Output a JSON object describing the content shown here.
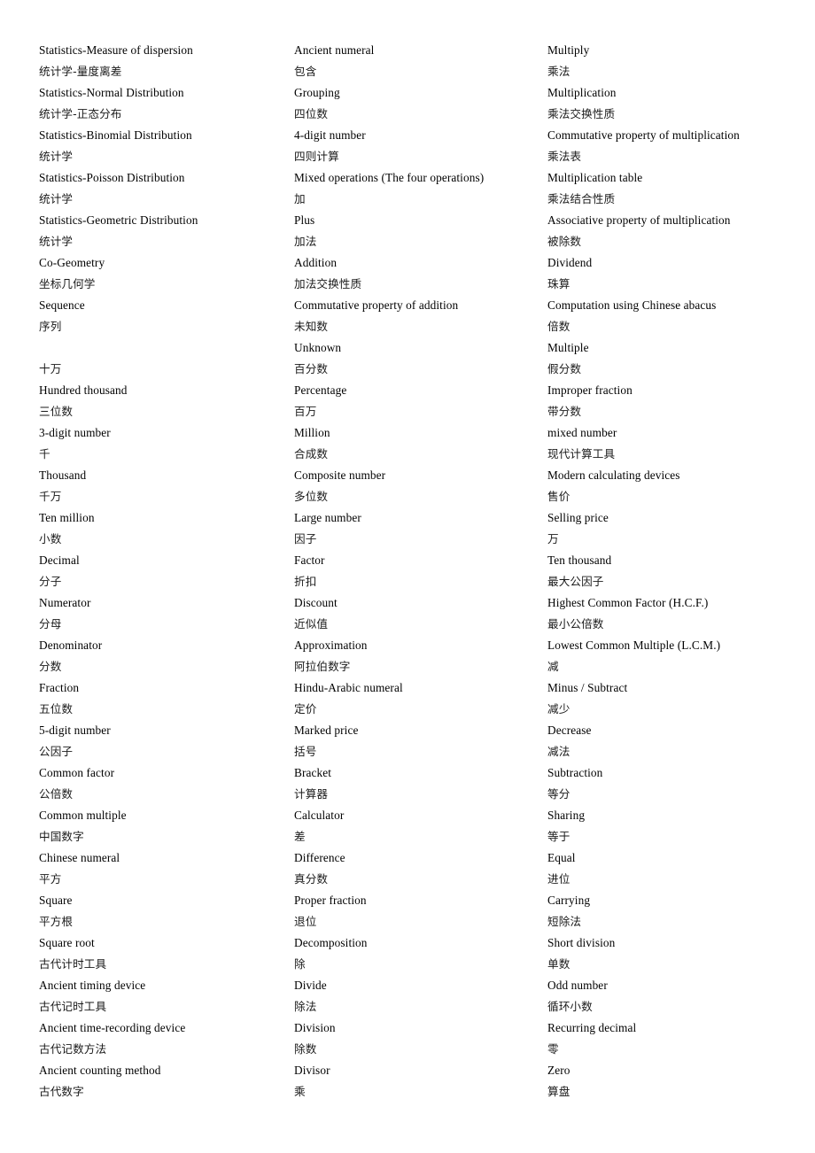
{
  "document": {
    "title": "Mathematics Glossary (Chinese-English)",
    "background_color": "#ffffff",
    "text_color": "#000000",
    "layout": "three-column term list"
  },
  "columns": [
    {
      "name": "column-1",
      "lines": [
        {
          "lang": "en",
          "text": "Statistics-Measure of dispersion"
        },
        {
          "lang": "zh",
          "text": "统计学-量度离差"
        },
        {
          "lang": "en",
          "text": "Statistics-Normal Distribution"
        },
        {
          "lang": "zh",
          "text": "统计学-正态分布"
        },
        {
          "lang": "en",
          "text": "Statistics-Binomial Distribution"
        },
        {
          "lang": "zh",
          "text": "统计学"
        },
        {
          "lang": "en",
          "text": "Statistics-Poisson Distribution"
        },
        {
          "lang": "zh",
          "text": "统计学"
        },
        {
          "lang": "en",
          "text": "Statistics-Geometric Distribution"
        },
        {
          "lang": "zh",
          "text": "统计学"
        },
        {
          "lang": "en",
          "text": "Co-Geometry"
        },
        {
          "lang": "zh",
          "text": "坐标几何学"
        },
        {
          "lang": "en",
          "text": "Sequence"
        },
        {
          "lang": "zh",
          "text": "序列"
        },
        {
          "lang": "blank",
          "text": ""
        },
        {
          "lang": "zh",
          "text": "十万"
        },
        {
          "lang": "en",
          "text": "Hundred thousand"
        },
        {
          "lang": "zh",
          "text": "三位数"
        },
        {
          "lang": "en",
          "text": "3-digit number"
        },
        {
          "lang": "zh",
          "text": "千"
        },
        {
          "lang": "en",
          "text": "Thousand"
        },
        {
          "lang": "zh",
          "text": "千万"
        },
        {
          "lang": "en",
          "text": "Ten million"
        },
        {
          "lang": "zh",
          "text": "小数"
        },
        {
          "lang": "en",
          "text": "Decimal"
        },
        {
          "lang": "zh",
          "text": "分子"
        },
        {
          "lang": "en",
          "text": "Numerator"
        },
        {
          "lang": "zh",
          "text": "分母"
        },
        {
          "lang": "en",
          "text": "Denominator"
        },
        {
          "lang": "zh",
          "text": "分数"
        },
        {
          "lang": "en",
          "text": "Fraction"
        },
        {
          "lang": "zh",
          "text": "五位数"
        },
        {
          "lang": "en",
          "text": "5-digit number"
        },
        {
          "lang": "zh",
          "text": "公因子"
        },
        {
          "lang": "en",
          "text": "Common factor"
        },
        {
          "lang": "zh",
          "text": "公倍数"
        },
        {
          "lang": "en",
          "text": "Common multiple"
        },
        {
          "lang": "zh",
          "text": "中国数字"
        },
        {
          "lang": "en",
          "text": "Chinese numeral"
        },
        {
          "lang": "zh",
          "text": "平方"
        },
        {
          "lang": "en",
          "text": "Square"
        },
        {
          "lang": "zh",
          "text": "平方根"
        },
        {
          "lang": "en",
          "text": "Square root"
        },
        {
          "lang": "zh",
          "text": "古代计时工具"
        },
        {
          "lang": "en",
          "text": "Ancient timing device"
        },
        {
          "lang": "zh",
          "text": "古代记时工具"
        },
        {
          "lang": "en",
          "text": "Ancient time-recording device"
        },
        {
          "lang": "zh",
          "text": "古代记数方法"
        },
        {
          "lang": "en",
          "text": "Ancient counting method"
        },
        {
          "lang": "zh",
          "text": "古代数字"
        }
      ]
    },
    {
      "name": "column-2",
      "lines": [
        {
          "lang": "en",
          "text": "Ancient numeral"
        },
        {
          "lang": "zh",
          "text": "包含"
        },
        {
          "lang": "en",
          "text": "Grouping"
        },
        {
          "lang": "zh",
          "text": "四位数"
        },
        {
          "lang": "en",
          "text": "4-digit number"
        },
        {
          "lang": "zh",
          "text": "四则计算"
        },
        {
          "lang": "en",
          "text": "Mixed operations (The four operations)"
        },
        {
          "lang": "zh",
          "text": "加"
        },
        {
          "lang": "en",
          "text": "Plus"
        },
        {
          "lang": "zh",
          "text": "加法"
        },
        {
          "lang": "en",
          "text": "Addition"
        },
        {
          "lang": "zh",
          "text": "加法交换性质"
        },
        {
          "lang": "en",
          "text": "Commutative property of addition"
        },
        {
          "lang": "zh",
          "text": "未知数"
        },
        {
          "lang": "en",
          "text": "Unknown"
        },
        {
          "lang": "zh",
          "text": "百分数"
        },
        {
          "lang": "en",
          "text": "Percentage"
        },
        {
          "lang": "zh",
          "text": "百万"
        },
        {
          "lang": "en",
          "text": "Million"
        },
        {
          "lang": "zh",
          "text": "合成数"
        },
        {
          "lang": "en",
          "text": "Composite number"
        },
        {
          "lang": "zh",
          "text": "多位数"
        },
        {
          "lang": "en",
          "text": "Large number"
        },
        {
          "lang": "zh",
          "text": "因子"
        },
        {
          "lang": "en",
          "text": "Factor"
        },
        {
          "lang": "zh",
          "text": "折扣"
        },
        {
          "lang": "en",
          "text": "Discount"
        },
        {
          "lang": "zh",
          "text": "近似值"
        },
        {
          "lang": "en",
          "text": "Approximation"
        },
        {
          "lang": "zh",
          "text": "阿拉伯数字"
        },
        {
          "lang": "en",
          "text": "Hindu-Arabic numeral"
        },
        {
          "lang": "zh",
          "text": "定价"
        },
        {
          "lang": "en",
          "text": "Marked price"
        },
        {
          "lang": "zh",
          "text": "括号"
        },
        {
          "lang": "en",
          "text": "Bracket"
        },
        {
          "lang": "zh",
          "text": "计算器"
        },
        {
          "lang": "en",
          "text": "Calculator"
        },
        {
          "lang": "zh",
          "text": "差"
        },
        {
          "lang": "en",
          "text": "Difference"
        },
        {
          "lang": "zh",
          "text": "真分数"
        },
        {
          "lang": "en",
          "text": "Proper fraction"
        },
        {
          "lang": "zh",
          "text": "退位"
        },
        {
          "lang": "en",
          "text": "Decomposition"
        },
        {
          "lang": "zh",
          "text": "除"
        },
        {
          "lang": "en",
          "text": "Divide"
        },
        {
          "lang": "zh",
          "text": "除法"
        },
        {
          "lang": "en",
          "text": "Division"
        },
        {
          "lang": "zh",
          "text": "除数"
        },
        {
          "lang": "en",
          "text": "Divisor"
        },
        {
          "lang": "zh",
          "text": "乘"
        }
      ]
    },
    {
      "name": "column-3",
      "lines": [
        {
          "lang": "en",
          "text": "Multiply"
        },
        {
          "lang": "zh",
          "text": "乘法"
        },
        {
          "lang": "en",
          "text": "Multiplication"
        },
        {
          "lang": "zh",
          "text": "乘法交换性质"
        },
        {
          "lang": "en",
          "text": "Commutative property of multiplication"
        },
        {
          "lang": "zh",
          "text": "乘法表"
        },
        {
          "lang": "en",
          "text": "Multiplication table"
        },
        {
          "lang": "zh",
          "text": "乘法结合性质"
        },
        {
          "lang": "en",
          "text": "Associative property of multiplication"
        },
        {
          "lang": "zh",
          "text": "被除数"
        },
        {
          "lang": "en",
          "text": "Dividend"
        },
        {
          "lang": "zh",
          "text": "珠算"
        },
        {
          "lang": "en",
          "text": "Computation using Chinese abacus"
        },
        {
          "lang": "zh",
          "text": "倍数"
        },
        {
          "lang": "en",
          "text": "Multiple"
        },
        {
          "lang": "zh",
          "text": "假分数"
        },
        {
          "lang": "en",
          "text": "Improper fraction"
        },
        {
          "lang": "zh",
          "text": "带分数"
        },
        {
          "lang": "en",
          "text": "mixed number"
        },
        {
          "lang": "zh",
          "text": "现代计算工具"
        },
        {
          "lang": "en",
          "text": "Modern calculating devices"
        },
        {
          "lang": "zh",
          "text": "售价"
        },
        {
          "lang": "en",
          "text": "Selling price"
        },
        {
          "lang": "zh",
          "text": "万"
        },
        {
          "lang": "en",
          "text": "Ten thousand"
        },
        {
          "lang": "zh",
          "text": "最大公因子"
        },
        {
          "lang": "en",
          "text": "Highest Common Factor (H.C.F.)"
        },
        {
          "lang": "zh",
          "text": "最小公倍数"
        },
        {
          "lang": "en",
          "text": "Lowest Common Multiple (L.C.M.)"
        },
        {
          "lang": "zh",
          "text": "减"
        },
        {
          "lang": "en",
          "text": "Minus / Subtract"
        },
        {
          "lang": "zh",
          "text": "减少"
        },
        {
          "lang": "en",
          "text": "Decrease"
        },
        {
          "lang": "zh",
          "text": "减法"
        },
        {
          "lang": "en",
          "text": "Subtraction"
        },
        {
          "lang": "zh",
          "text": "等分"
        },
        {
          "lang": "en",
          "text": "Sharing"
        },
        {
          "lang": "zh",
          "text": "等于"
        },
        {
          "lang": "en",
          "text": "Equal"
        },
        {
          "lang": "zh",
          "text": "进位"
        },
        {
          "lang": "en",
          "text": "Carrying"
        },
        {
          "lang": "zh",
          "text": "短除法"
        },
        {
          "lang": "en",
          "text": "Short division"
        },
        {
          "lang": "zh",
          "text": "单数"
        },
        {
          "lang": "en",
          "text": "Odd number"
        },
        {
          "lang": "zh",
          "text": "循环小数"
        },
        {
          "lang": "en",
          "text": "Recurring decimal"
        },
        {
          "lang": "zh",
          "text": "零"
        },
        {
          "lang": "en",
          "text": "Zero"
        },
        {
          "lang": "zh",
          "text": "算盘"
        }
      ]
    }
  ]
}
